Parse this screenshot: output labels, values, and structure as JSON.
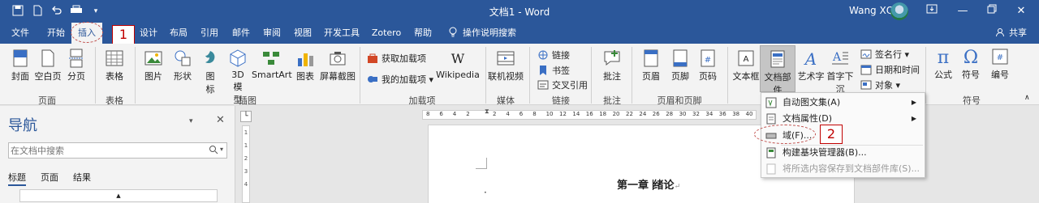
{
  "window": {
    "doc_title": "文档1 - Word",
    "user_name": "Wang XQ",
    "avatar": "avatar-icon",
    "share_label": "共享"
  },
  "quick_access": [
    {
      "icon": "save-icon"
    },
    {
      "icon": "new-icon"
    },
    {
      "icon": "undo-icon"
    },
    {
      "icon": "print-preview-icon"
    },
    {
      "icon": "customize-icon"
    }
  ],
  "tabs": [
    "文件",
    "开始",
    "插入",
    "设计",
    "布局",
    "引用",
    "邮件",
    "审阅",
    "视图",
    "开发工具",
    "Zotero",
    "帮助"
  ],
  "tell_me": "操作说明搜索",
  "ribbon": {
    "groups": {
      "pages": "页面",
      "table": "表格",
      "illustrations": "插图",
      "addins": "加载项",
      "media": "媒体",
      "links": "链接",
      "comments": "批注",
      "header_footer": "页眉和页脚",
      "symbols": "符号"
    },
    "buttons": {
      "cover": "封面",
      "blank_page": "空白页",
      "page_break": "分页",
      "table": "表格",
      "pictures": "图片",
      "shapes": "形状",
      "icons_l1": "图",
      "icons_l2": "标",
      "model_l1": "3D",
      "model_l2": "模",
      "model_l3": "型",
      "smartart": "SmartArt",
      "chart": "图表",
      "screenshot": "屏幕截图",
      "get_addins": "获取加载项",
      "my_addins": "我的加载项",
      "wikipedia": "Wikipedia",
      "online_video": "联机视频",
      "link": "链接",
      "bookmark": "书签",
      "cross_ref": "交叉引用",
      "comment": "批注",
      "header": "页眉",
      "footer": "页脚",
      "page_number": "页码",
      "text_box": "文本框",
      "quick_parts": "文档部件",
      "wordart": "艺术字",
      "drop_cap": "首字下沉",
      "signature_line": "签名行",
      "date_time": "日期和时间",
      "object": "对象",
      "equation": "公式",
      "symbol": "符号",
      "numbering": "编号"
    }
  },
  "nav_pane": {
    "title": "导航",
    "search_placeholder": "在文档中搜索",
    "tabs": [
      "标题",
      "页面",
      "结果"
    ]
  },
  "ruler_numbers": [
    "8",
    "6",
    "4",
    "2",
    "",
    "2",
    "4",
    "6",
    "8",
    "10",
    "12",
    "14",
    "16",
    "18",
    "20",
    "22",
    "24",
    "26",
    "28",
    "30",
    "32",
    "34",
    "36",
    "38",
    "40"
  ],
  "document": {
    "heading_a": "第一章",
    "heading_b": "绪论"
  },
  "quick_parts_menu": [
    {
      "label": "自动图文集(A)",
      "submenu": true,
      "disabled": false
    },
    {
      "label": "文档属性(D)",
      "submenu": true,
      "disabled": false
    },
    {
      "label": "域(F)...",
      "submenu": false,
      "disabled": false
    },
    {
      "label": "构建基块管理器(B)...",
      "submenu": false,
      "disabled": false
    },
    {
      "label": "将所选内容保存到文档部件库(S)...",
      "submenu": false,
      "disabled": true
    }
  ],
  "callouts": [
    "1",
    "2"
  ],
  "colors": {
    "titlebar": "#2b579a",
    "ribbon": "#f3f3f3",
    "callout": "#c00000"
  }
}
